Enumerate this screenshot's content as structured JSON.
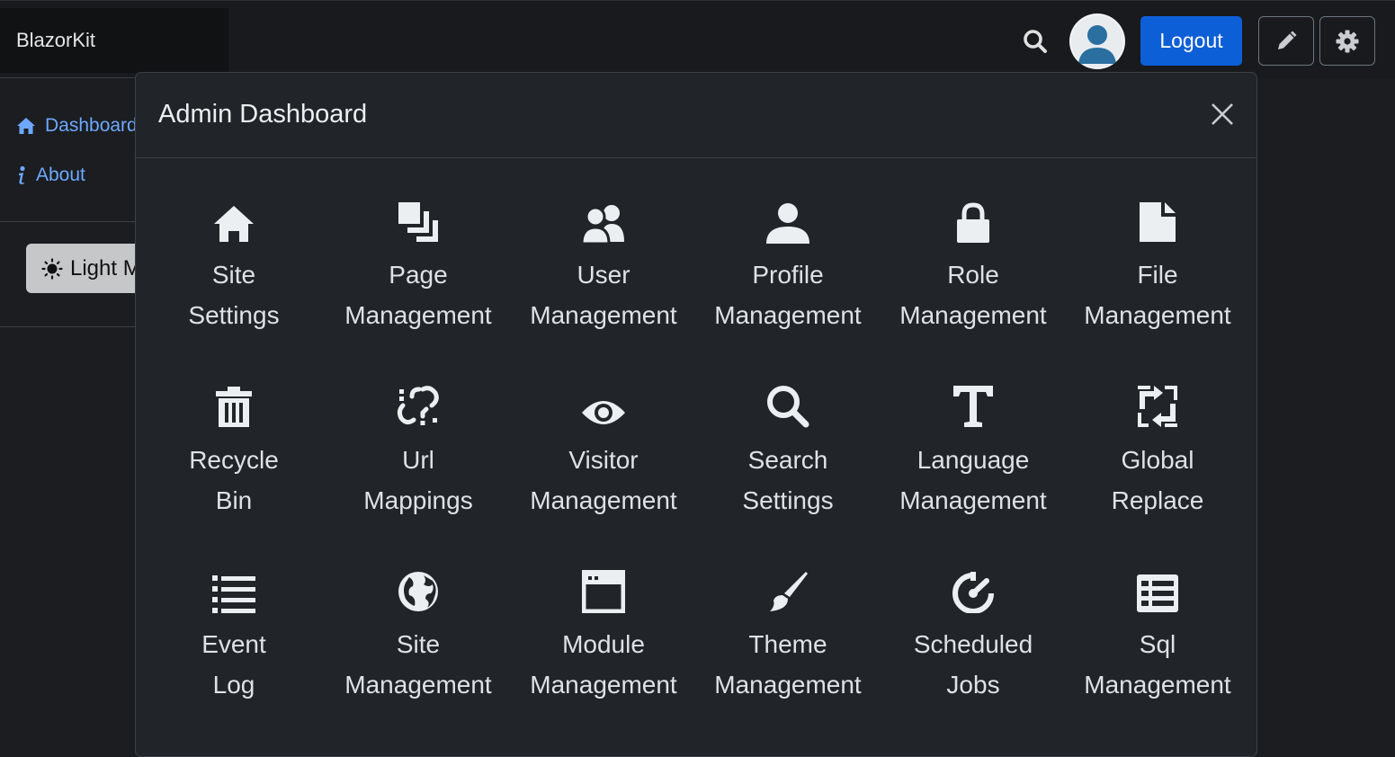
{
  "brand": "BlazorKit",
  "header": {
    "logout_label": "Logout"
  },
  "sidebar": {
    "items": [
      {
        "label": "Dashboard",
        "icon": "home-icon"
      },
      {
        "label": "About",
        "icon": "info-icon"
      }
    ],
    "theme_toggle_label": "Light Mode"
  },
  "modal": {
    "title": "Admin Dashboard",
    "tiles": [
      {
        "line1": "Site",
        "line2": "Settings",
        "icon": "home-icon"
      },
      {
        "line1": "Page",
        "line2": "Management",
        "icon": "clone-icon"
      },
      {
        "line1": "User",
        "line2": "Management",
        "icon": "users-icon"
      },
      {
        "line1": "Profile",
        "line2": "Management",
        "icon": "user-icon"
      },
      {
        "line1": "Role",
        "line2": "Management",
        "icon": "lock-icon"
      },
      {
        "line1": "File",
        "line2": "Management",
        "icon": "file-icon"
      },
      {
        "line1": "Recycle",
        "line2": "Bin",
        "icon": "trash-icon"
      },
      {
        "line1": "Url",
        "line2": "Mappings",
        "icon": "broken-link-icon"
      },
      {
        "line1": "Visitor",
        "line2": "Management",
        "icon": "eye-icon"
      },
      {
        "line1": "Search",
        "line2": "Settings",
        "icon": "search-icon"
      },
      {
        "line1": "Language",
        "line2": "Management",
        "icon": "text-icon"
      },
      {
        "line1": "Global",
        "line2": "Replace",
        "icon": "replace-icon"
      },
      {
        "line1": "Event",
        "line2": "Log",
        "icon": "list-icon"
      },
      {
        "line1": "Site",
        "line2": "Management",
        "icon": "globe-icon"
      },
      {
        "line1": "Module",
        "line2": "Management",
        "icon": "window-icon"
      },
      {
        "line1": "Theme",
        "line2": "Management",
        "icon": "brush-icon"
      },
      {
        "line1": "Scheduled",
        "line2": "Jobs",
        "icon": "timer-icon"
      },
      {
        "line1": "Sql",
        "line2": "Management",
        "icon": "table-icon"
      }
    ]
  },
  "colors": {
    "accent": "#0d5fd8",
    "link": "#6ea8fe",
    "modal_bg": "#212529",
    "page_bg": "#1b1d21"
  }
}
